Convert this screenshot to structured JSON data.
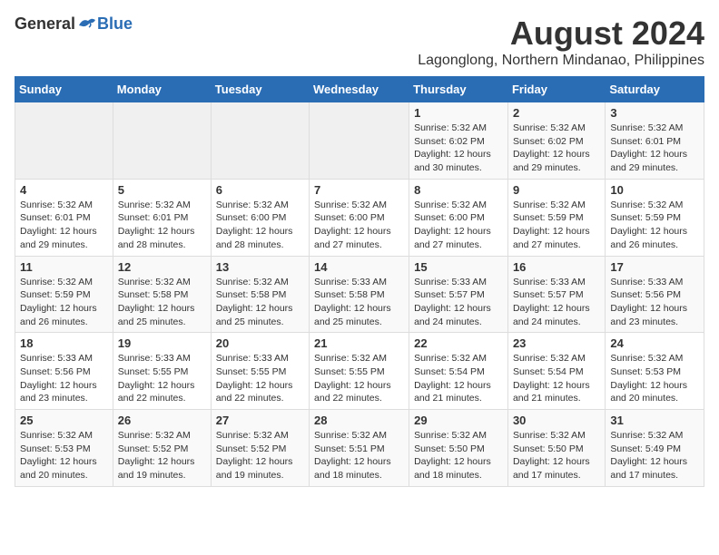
{
  "logo": {
    "general": "General",
    "blue": "Blue"
  },
  "title": "August 2024",
  "subtitle": "Lagonglong, Northern Mindanao, Philippines",
  "days_header": [
    "Sunday",
    "Monday",
    "Tuesday",
    "Wednesday",
    "Thursday",
    "Friday",
    "Saturday"
  ],
  "weeks": [
    [
      {
        "day": "",
        "info": ""
      },
      {
        "day": "",
        "info": ""
      },
      {
        "day": "",
        "info": ""
      },
      {
        "day": "",
        "info": ""
      },
      {
        "day": "1",
        "info": "Sunrise: 5:32 AM\nSunset: 6:02 PM\nDaylight: 12 hours\nand 30 minutes."
      },
      {
        "day": "2",
        "info": "Sunrise: 5:32 AM\nSunset: 6:02 PM\nDaylight: 12 hours\nand 29 minutes."
      },
      {
        "day": "3",
        "info": "Sunrise: 5:32 AM\nSunset: 6:01 PM\nDaylight: 12 hours\nand 29 minutes."
      }
    ],
    [
      {
        "day": "4",
        "info": "Sunrise: 5:32 AM\nSunset: 6:01 PM\nDaylight: 12 hours\nand 29 minutes."
      },
      {
        "day": "5",
        "info": "Sunrise: 5:32 AM\nSunset: 6:01 PM\nDaylight: 12 hours\nand 28 minutes."
      },
      {
        "day": "6",
        "info": "Sunrise: 5:32 AM\nSunset: 6:00 PM\nDaylight: 12 hours\nand 28 minutes."
      },
      {
        "day": "7",
        "info": "Sunrise: 5:32 AM\nSunset: 6:00 PM\nDaylight: 12 hours\nand 27 minutes."
      },
      {
        "day": "8",
        "info": "Sunrise: 5:32 AM\nSunset: 6:00 PM\nDaylight: 12 hours\nand 27 minutes."
      },
      {
        "day": "9",
        "info": "Sunrise: 5:32 AM\nSunset: 5:59 PM\nDaylight: 12 hours\nand 27 minutes."
      },
      {
        "day": "10",
        "info": "Sunrise: 5:32 AM\nSunset: 5:59 PM\nDaylight: 12 hours\nand 26 minutes."
      }
    ],
    [
      {
        "day": "11",
        "info": "Sunrise: 5:32 AM\nSunset: 5:59 PM\nDaylight: 12 hours\nand 26 minutes."
      },
      {
        "day": "12",
        "info": "Sunrise: 5:32 AM\nSunset: 5:58 PM\nDaylight: 12 hours\nand 25 minutes."
      },
      {
        "day": "13",
        "info": "Sunrise: 5:32 AM\nSunset: 5:58 PM\nDaylight: 12 hours\nand 25 minutes."
      },
      {
        "day": "14",
        "info": "Sunrise: 5:33 AM\nSunset: 5:58 PM\nDaylight: 12 hours\nand 25 minutes."
      },
      {
        "day": "15",
        "info": "Sunrise: 5:33 AM\nSunset: 5:57 PM\nDaylight: 12 hours\nand 24 minutes."
      },
      {
        "day": "16",
        "info": "Sunrise: 5:33 AM\nSunset: 5:57 PM\nDaylight: 12 hours\nand 24 minutes."
      },
      {
        "day": "17",
        "info": "Sunrise: 5:33 AM\nSunset: 5:56 PM\nDaylight: 12 hours\nand 23 minutes."
      }
    ],
    [
      {
        "day": "18",
        "info": "Sunrise: 5:33 AM\nSunset: 5:56 PM\nDaylight: 12 hours\nand 23 minutes."
      },
      {
        "day": "19",
        "info": "Sunrise: 5:33 AM\nSunset: 5:55 PM\nDaylight: 12 hours\nand 22 minutes."
      },
      {
        "day": "20",
        "info": "Sunrise: 5:33 AM\nSunset: 5:55 PM\nDaylight: 12 hours\nand 22 minutes."
      },
      {
        "day": "21",
        "info": "Sunrise: 5:32 AM\nSunset: 5:55 PM\nDaylight: 12 hours\nand 22 minutes."
      },
      {
        "day": "22",
        "info": "Sunrise: 5:32 AM\nSunset: 5:54 PM\nDaylight: 12 hours\nand 21 minutes."
      },
      {
        "day": "23",
        "info": "Sunrise: 5:32 AM\nSunset: 5:54 PM\nDaylight: 12 hours\nand 21 minutes."
      },
      {
        "day": "24",
        "info": "Sunrise: 5:32 AM\nSunset: 5:53 PM\nDaylight: 12 hours\nand 20 minutes."
      }
    ],
    [
      {
        "day": "25",
        "info": "Sunrise: 5:32 AM\nSunset: 5:53 PM\nDaylight: 12 hours\nand 20 minutes."
      },
      {
        "day": "26",
        "info": "Sunrise: 5:32 AM\nSunset: 5:52 PM\nDaylight: 12 hours\nand 19 minutes."
      },
      {
        "day": "27",
        "info": "Sunrise: 5:32 AM\nSunset: 5:52 PM\nDaylight: 12 hours\nand 19 minutes."
      },
      {
        "day": "28",
        "info": "Sunrise: 5:32 AM\nSunset: 5:51 PM\nDaylight: 12 hours\nand 18 minutes."
      },
      {
        "day": "29",
        "info": "Sunrise: 5:32 AM\nSunset: 5:50 PM\nDaylight: 12 hours\nand 18 minutes."
      },
      {
        "day": "30",
        "info": "Sunrise: 5:32 AM\nSunset: 5:50 PM\nDaylight: 12 hours\nand 17 minutes."
      },
      {
        "day": "31",
        "info": "Sunrise: 5:32 AM\nSunset: 5:49 PM\nDaylight: 12 hours\nand 17 minutes."
      }
    ]
  ]
}
